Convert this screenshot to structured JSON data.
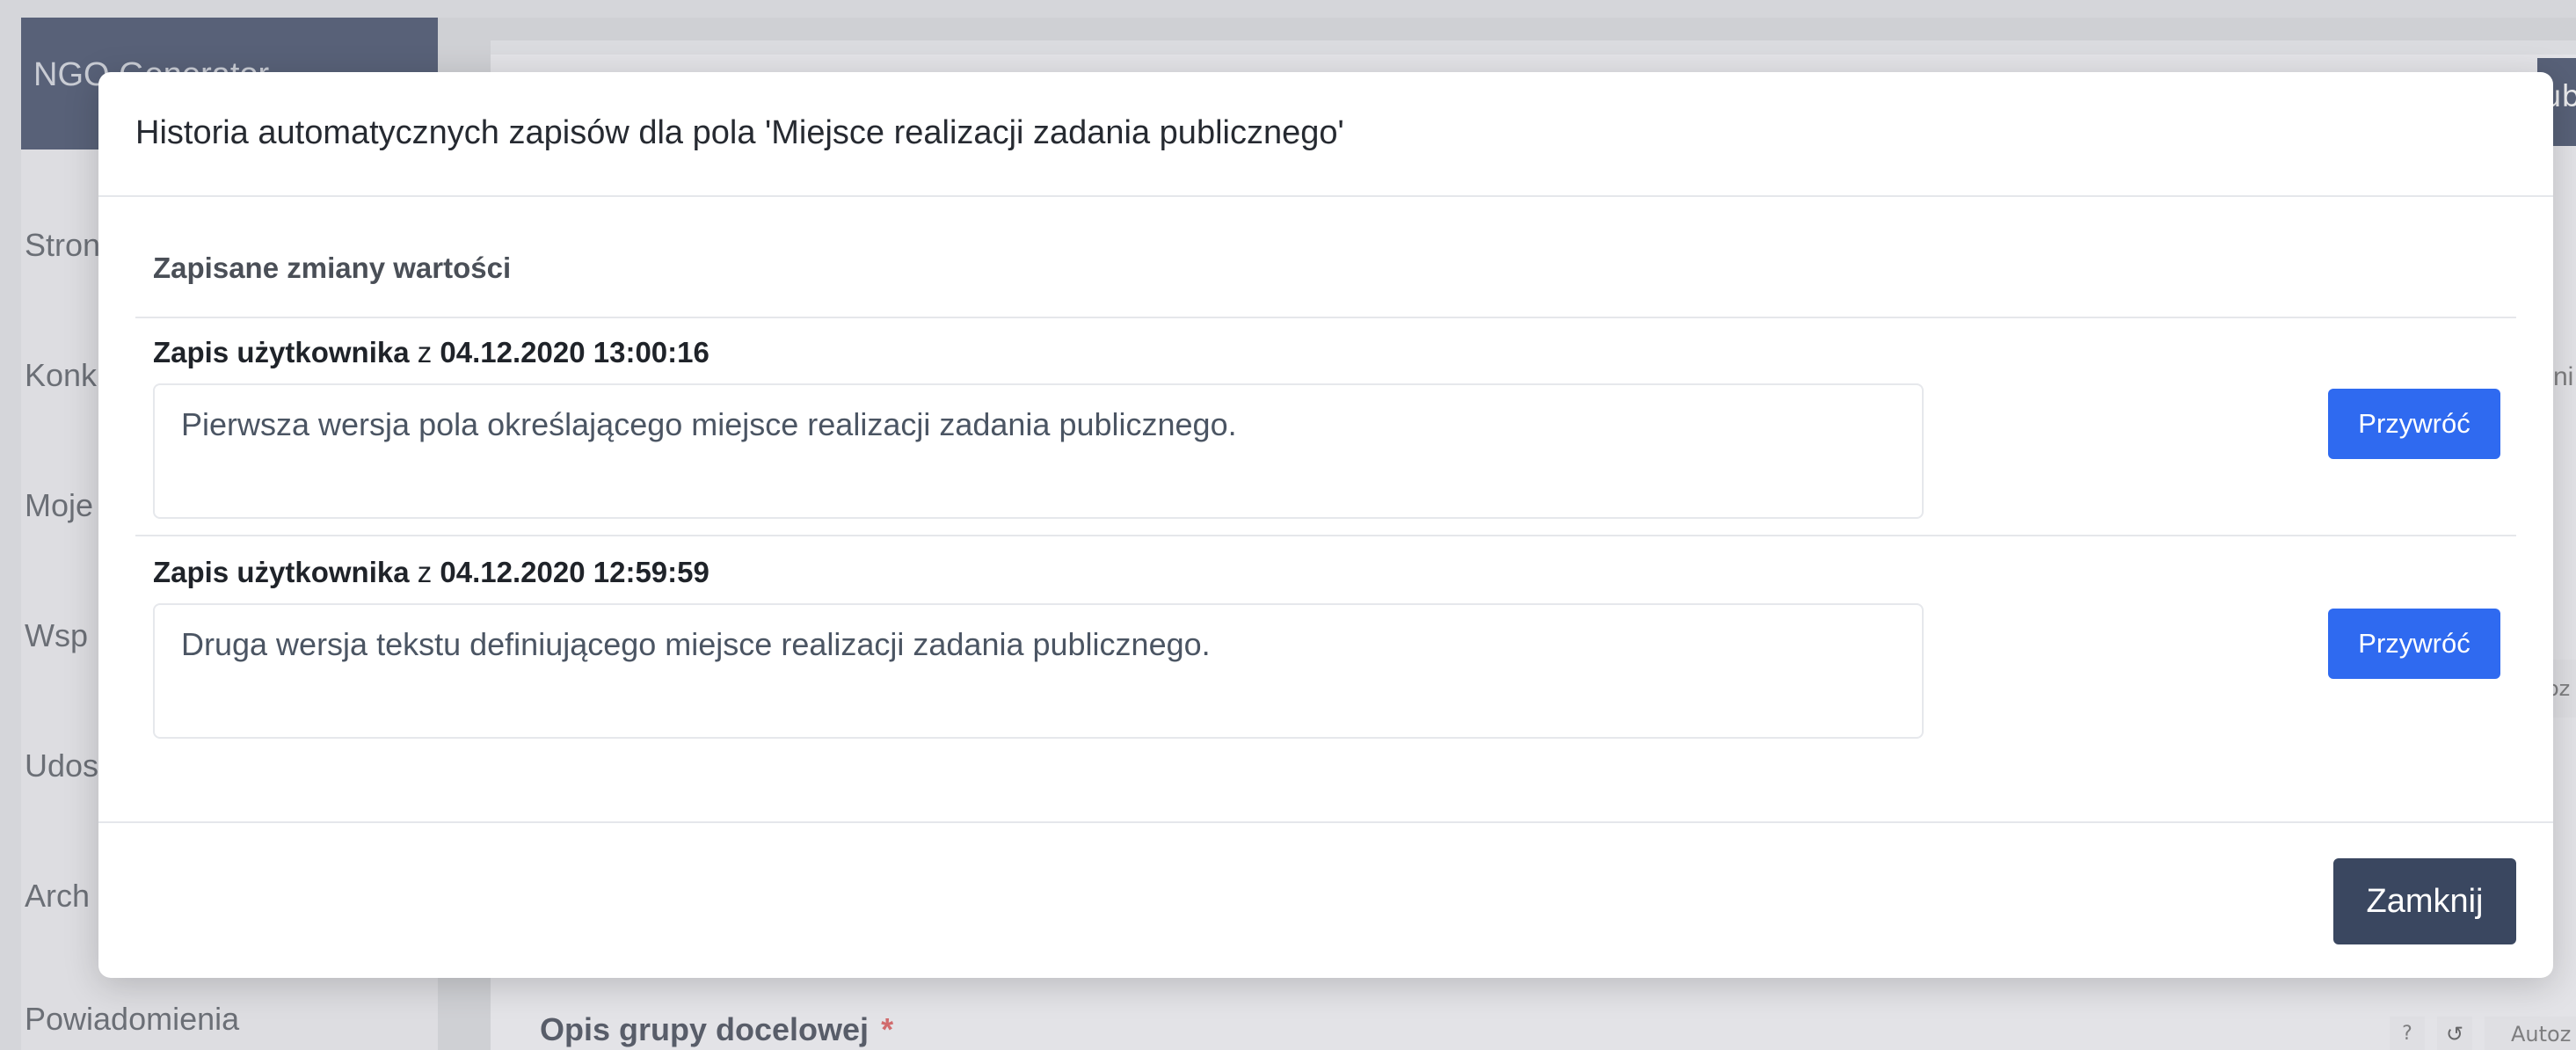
{
  "app": {
    "brand": "NGO Generator",
    "sidebar_items": [
      "Stron",
      "Konk",
      "Moje",
      "Wsp",
      "Udos",
      "Arch",
      "Powiadomienia"
    ],
    "top_button_label": "ub",
    "peek_right_1": "ni",
    "peek_right_2": "oz",
    "field_title": "Opis grupy docelowej",
    "required_mark": "*",
    "help_label": "?",
    "history_icon": "history-icon",
    "autosave_label": "Autoz"
  },
  "modal": {
    "title": "Historia automatycznych zapisów dla pola 'Miejsce realizacji zadania publicznego'",
    "section_title": "Zapisane zmiany wartości",
    "entries": [
      {
        "label_bold": "Zapis użytkownika",
        "label_sep": "z",
        "timestamp": "04.12.2020 13:00:16",
        "text": "Pierwsza wersja pola określającego miejsce realizacji zadania publicznego.",
        "restore_label": "Przywróć"
      },
      {
        "label_bold": "Zapis użytkownika",
        "label_sep": "z",
        "timestamp": "04.12.2020 12:59:59",
        "text": "Druga wersja tekstu definiującego miejsce realizacji zadania publicznego.",
        "restore_label": "Przywróć"
      }
    ],
    "close_label": "Zamknij"
  },
  "colors": {
    "primary": "#2f6af0",
    "dark_button": "#3a4760",
    "brand_bg": "#1d2a4a",
    "required": "#d63a3a"
  }
}
